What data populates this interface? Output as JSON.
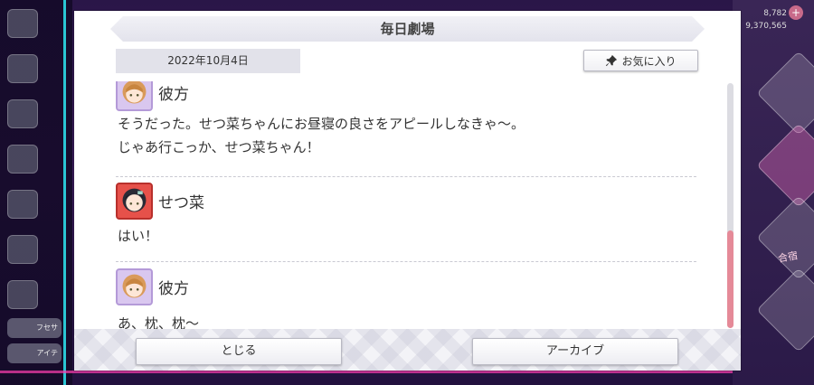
{
  "background": {
    "stat_1": "8,782",
    "stat_2": "9,370,565",
    "side_pill_1": "フセサ",
    "side_pill_2": "アイテ",
    "diamond_label": "合宿"
  },
  "dialog": {
    "title": "毎日劇場",
    "date": "2022年10月4日",
    "favorite_label": "お気に入り",
    "entries": [
      {
        "speaker": "彼方",
        "lines": [
          "そうだった。せつ菜ちゃんにお昼寝の良さをアピールしなきゃ〜。",
          "じゃあ行こっか、せつ菜ちゃん！"
        ]
      },
      {
        "speaker": "せつ菜",
        "lines": [
          "はい！"
        ]
      },
      {
        "speaker": "彼方",
        "lines": [
          "あ、枕、枕〜"
        ]
      }
    ],
    "close_label": "とじる",
    "archive_label": "アーカイブ"
  },
  "colors": {
    "scroll_thumb": "#e58a98",
    "kanata_frame": "#b49ad8",
    "setsuna_frame": "#b8302c"
  }
}
